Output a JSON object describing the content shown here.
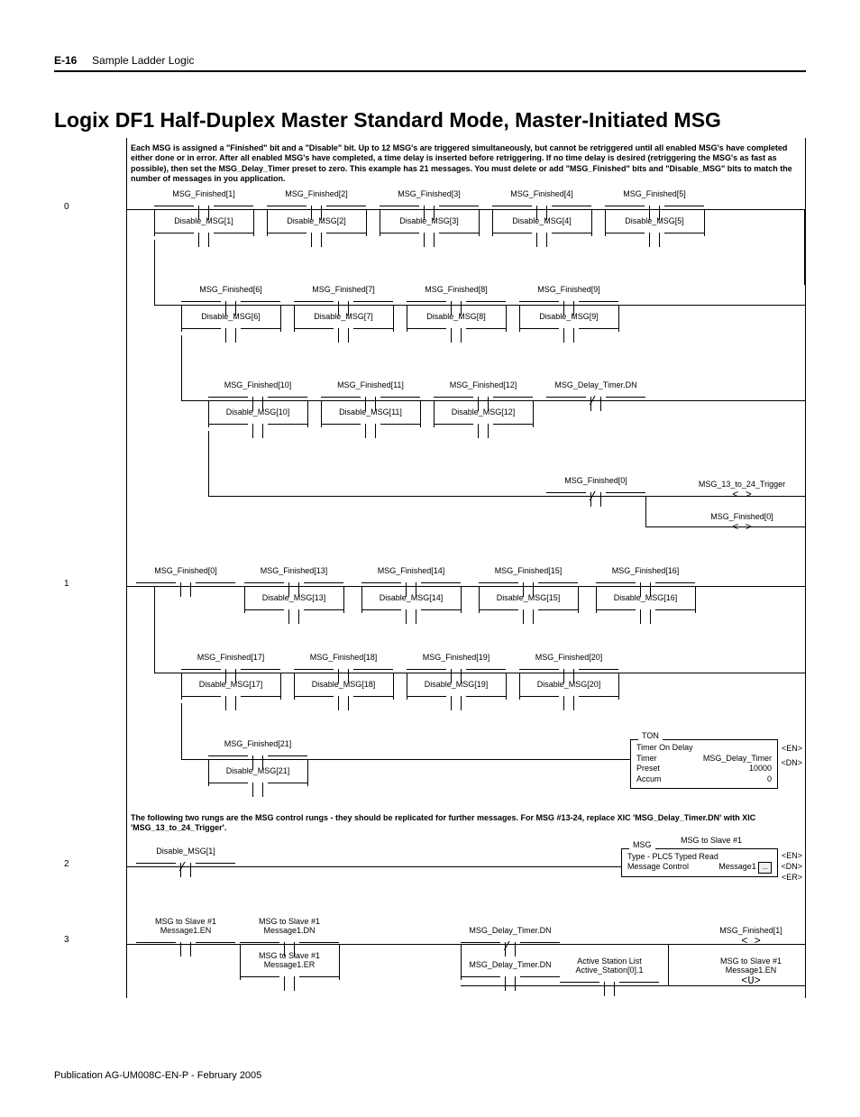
{
  "page_header": {
    "num": "E-16",
    "section": "Sample Ladder Logic"
  },
  "title": "Logix DF1 Half-Duplex Master Standard Mode, Master-Initiated MSG",
  "desc1": "Each MSG is assigned a \"Finished\" bit and a \"Disable\" bit. Up to 12 MSG's are triggered simultaneously, but cannot be retriggered until all enabled MSG's have completed either done or in error. After all enabled MSG's have completed, a time delay is inserted before retriggering. If no time delay is desired (retriggering the MSG's as fast as possible), then set the MSG_Delay_Timer preset to zero. This example has 21 messages. You must delete or add \"MSG_Finished\" bits and \"Disable_MSG\" bits to match the number of messages in you application.",
  "desc2": "The following two rungs are the MSG control rungs - they should be replicated for further messages. For MSG #13-24, replace XIC 'MSG_Delay_Timer.DN' with XIC 'MSG_13_to_24_Trigger'.",
  "rows": {
    "r0": {
      "c1": "MSG_Finished[1]",
      "c2": "MSG_Finished[2]",
      "c3": "MSG_Finished[3]",
      "c4": "MSG_Finished[4]",
      "c5": "MSG_Finished[5]",
      "d1": "Disable_MSG[1]",
      "d2": "Disable_MSG[2]",
      "d3": "Disable_MSG[3]",
      "d4": "Disable_MSG[4]",
      "d5": "Disable_MSG[5]"
    },
    "r0b": {
      "c1": "MSG_Finished[6]",
      "c2": "MSG_Finished[7]",
      "c3": "MSG_Finished[8]",
      "c4": "MSG_Finished[9]",
      "d1": "Disable_MSG[6]",
      "d2": "Disable_MSG[7]",
      "d3": "Disable_MSG[8]",
      "d4": "Disable_MSG[9]"
    },
    "r0c": {
      "c1": "MSG_Finished[10]",
      "c2": "MSG_Finished[11]",
      "c3": "MSG_Finished[12]",
      "c4": "MSG_Delay_Timer.DN",
      "d1": "Disable_MSG[10]",
      "d2": "Disable_MSG[11]",
      "d3": "Disable_MSG[12]"
    },
    "r0d": {
      "c1": "MSG_Finished[0]",
      "o1": "MSG_13_to_24_Trigger",
      "o2": "MSG_Finished[0]"
    },
    "r1": {
      "c0": "MSG_Finished[0]",
      "c1": "MSG_Finished[13]",
      "c2": "MSG_Finished[14]",
      "c3": "MSG_Finished[15]",
      "c4": "MSG_Finished[16]",
      "d1": "Disable_MSG[13]",
      "d2": "Disable_MSG[14]",
      "d3": "Disable_MSG[15]",
      "d4": "Disable_MSG[16]"
    },
    "r1b": {
      "c1": "MSG_Finished[17]",
      "c2": "MSG_Finished[18]",
      "c3": "MSG_Finished[19]",
      "c4": "MSG_Finished[20]",
      "d1": "Disable_MSG[17]",
      "d2": "Disable_MSG[18]",
      "d3": "Disable_MSG[19]",
      "d4": "Disable_MSG[20]"
    },
    "r1c": {
      "c1": "MSG_Finished[21]",
      "d1": "Disable_MSG[21]"
    },
    "ton": {
      "hd": "TON",
      "l1": "Timer On Delay",
      "l2a": "Timer",
      "l2b": "MSG_Delay_Timer",
      "l3a": "Preset",
      "l3b": "10000",
      "l4a": "Accum",
      "l4b": "0",
      "io1": "EN",
      "io2": "DN"
    },
    "r2": {
      "hdr": "MSG to Slave #1",
      "c1": "Disable_MSG[1]",
      "msg": {
        "hd": "MSG",
        "l1": "Type - PLC5 Typed Read",
        "l2a": "Message Control",
        "l2b": "Message1",
        "io1": "EN",
        "io2": "DN",
        "io3": "ER"
      }
    },
    "r3": {
      "h1": "MSG to Slave #1",
      "c1": "Message1.EN",
      "h2": "MSG to Slave #1",
      "c2": "Message1.DN",
      "h3": "MSG to Slave #1",
      "c3": "Message1.ER",
      "c4": "MSG_Delay_Timer.DN",
      "c5": "MSG_Delay_Timer.DN",
      "o1": "MSG_Finished[1]",
      "as1": "Active Station List",
      "as2": "Active_Station[0].1",
      "u1": "MSG to Slave #1",
      "u2": "Message1.EN"
    }
  },
  "rung_numbers": {
    "n0": "0",
    "n1": "1",
    "n2": "2",
    "n3": "3"
  },
  "footer": "Publication AG-UM008C-EN-P - February 2005"
}
